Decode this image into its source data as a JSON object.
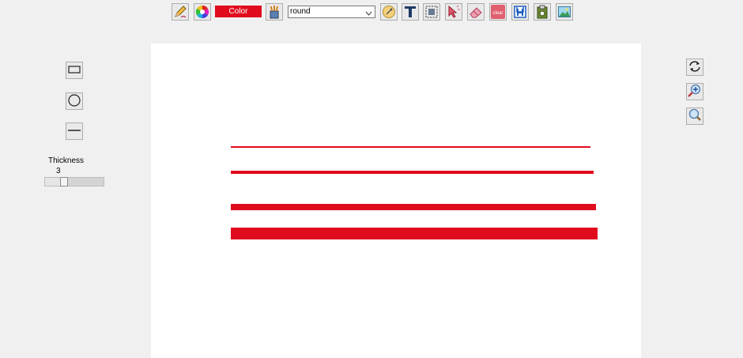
{
  "toolbar": {
    "color_label": "Color",
    "color_value": "#e10b1e",
    "line_cap_selected": "round",
    "icons": [
      "pencil-icon",
      "color-wheel-icon",
      "brush-cup-icon",
      "eyedropper-icon",
      "text-icon",
      "select-region-icon",
      "pointer-icon",
      "eraser-icon",
      "clear-icon",
      "save-icon",
      "clipboard-icon",
      "image-icon"
    ]
  },
  "clear_label": "clear",
  "left_panel": {
    "shapes": [
      "rectangle-icon",
      "circle-icon",
      "line-icon"
    ],
    "thickness_label": "Thickness",
    "thickness_value": "3",
    "thickness_fraction": 0.2
  },
  "right_panel": {
    "icons": [
      "refresh-icon",
      "zoom-in-icon",
      "zoom-out-icon"
    ]
  },
  "canvas": {
    "background": "#ffffff",
    "stroke_color": "#e10b1e"
  }
}
